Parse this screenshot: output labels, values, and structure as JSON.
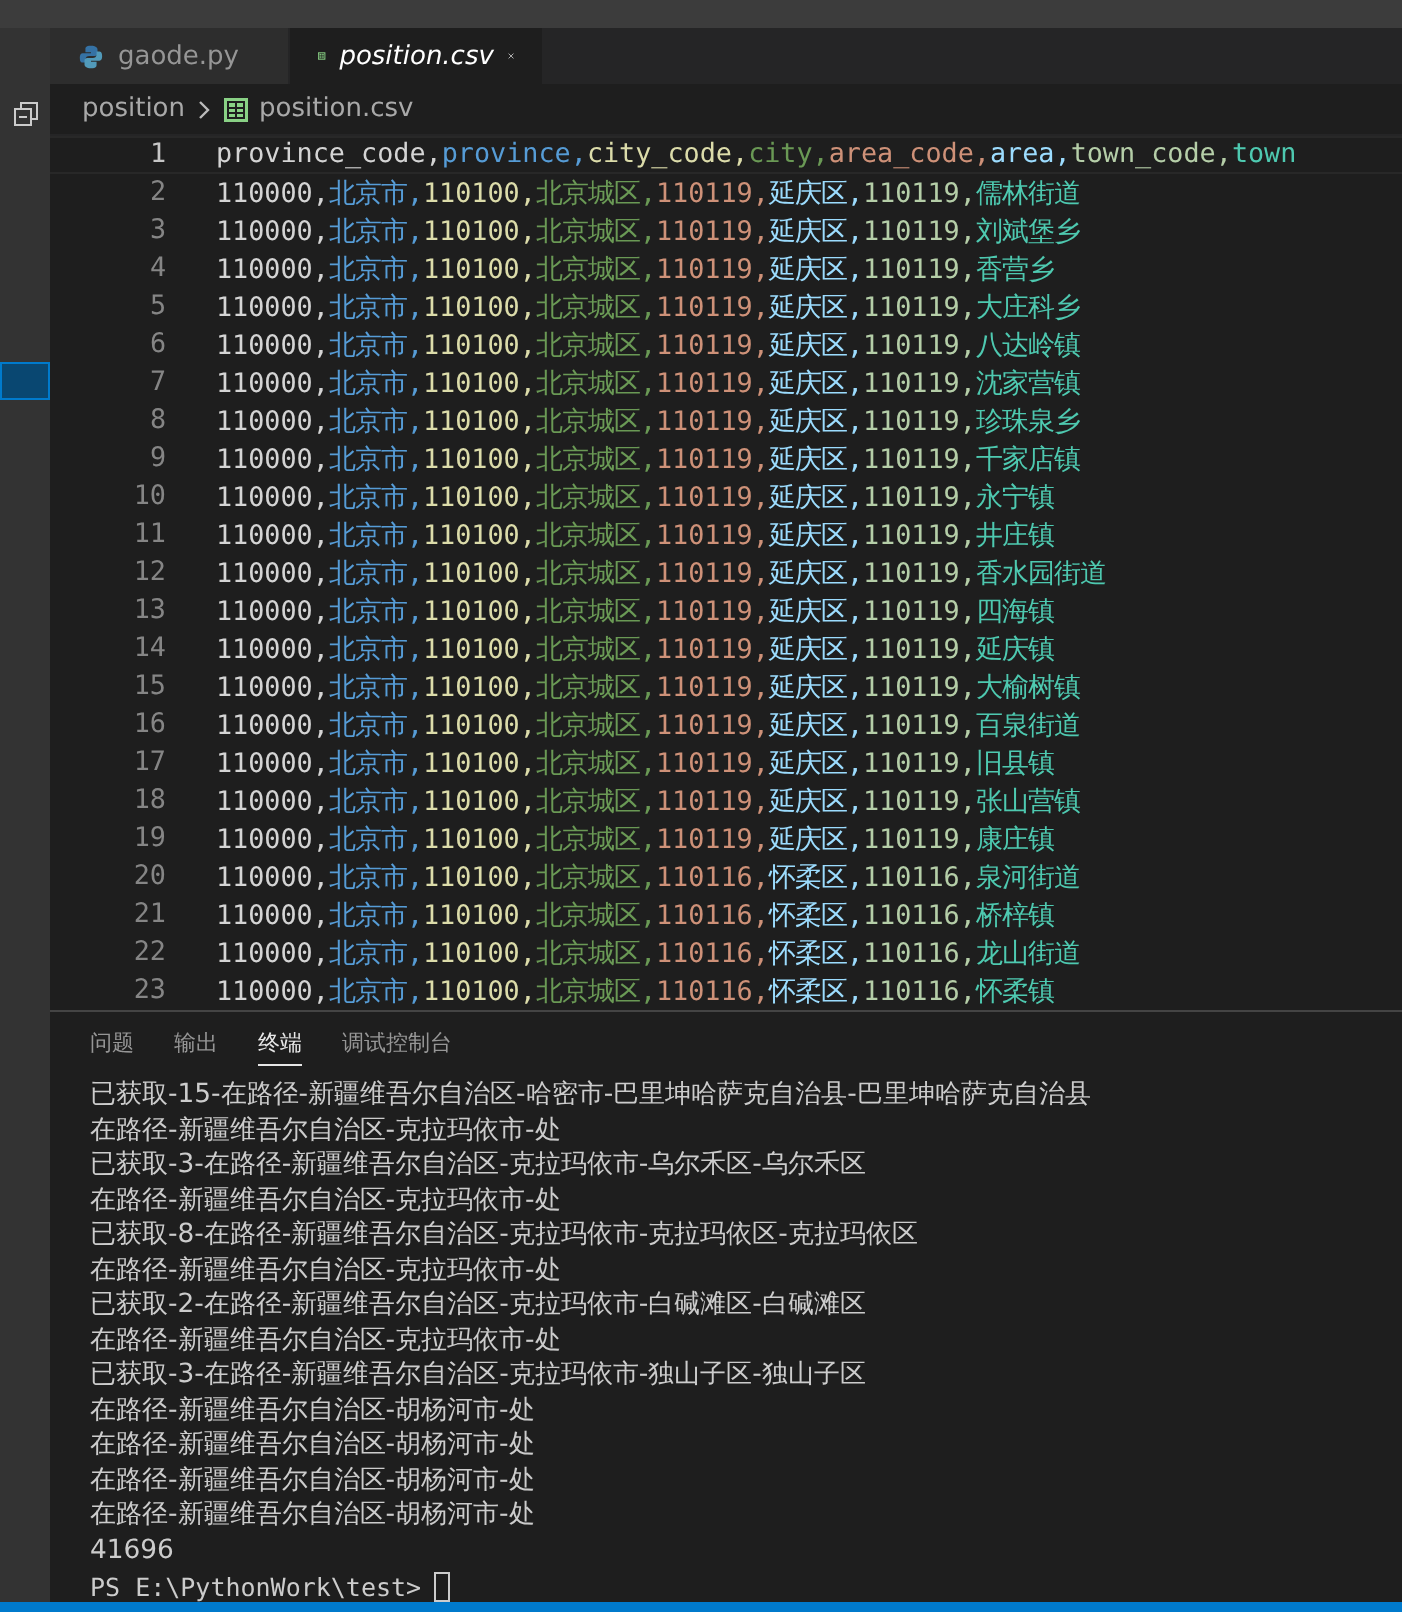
{
  "tabs": [
    {
      "label": "gaode.py",
      "kind": "python",
      "selected": false
    },
    {
      "label": "position.csv",
      "kind": "csv",
      "selected": true
    }
  ],
  "breadcrumb": {
    "folder": "position",
    "file": "position.csv"
  },
  "editor": {
    "lines": [
      {
        "number": "1",
        "fields": [
          "province_code,",
          "province,",
          "city_code,",
          "city,",
          "area_code,",
          "area,",
          "town_code,",
          "town"
        ]
      },
      {
        "number": "2",
        "fields": [
          "110000,",
          "北京市,",
          "110100,",
          "北京城区,",
          "110119,",
          "延庆区,",
          "110119,",
          "儒林街道"
        ]
      },
      {
        "number": "3",
        "fields": [
          "110000,",
          "北京市,",
          "110100,",
          "北京城区,",
          "110119,",
          "延庆区,",
          "110119,",
          "刘斌堡乡"
        ]
      },
      {
        "number": "4",
        "fields": [
          "110000,",
          "北京市,",
          "110100,",
          "北京城区,",
          "110119,",
          "延庆区,",
          "110119,",
          "香营乡"
        ]
      },
      {
        "number": "5",
        "fields": [
          "110000,",
          "北京市,",
          "110100,",
          "北京城区,",
          "110119,",
          "延庆区,",
          "110119,",
          "大庄科乡"
        ]
      },
      {
        "number": "6",
        "fields": [
          "110000,",
          "北京市,",
          "110100,",
          "北京城区,",
          "110119,",
          "延庆区,",
          "110119,",
          "八达岭镇"
        ]
      },
      {
        "number": "7",
        "fields": [
          "110000,",
          "北京市,",
          "110100,",
          "北京城区,",
          "110119,",
          "延庆区,",
          "110119,",
          "沈家营镇"
        ]
      },
      {
        "number": "8",
        "fields": [
          "110000,",
          "北京市,",
          "110100,",
          "北京城区,",
          "110119,",
          "延庆区,",
          "110119,",
          "珍珠泉乡"
        ]
      },
      {
        "number": "9",
        "fields": [
          "110000,",
          "北京市,",
          "110100,",
          "北京城区,",
          "110119,",
          "延庆区,",
          "110119,",
          "千家店镇"
        ]
      },
      {
        "number": "10",
        "fields": [
          "110000,",
          "北京市,",
          "110100,",
          "北京城区,",
          "110119,",
          "延庆区,",
          "110119,",
          "永宁镇"
        ]
      },
      {
        "number": "11",
        "fields": [
          "110000,",
          "北京市,",
          "110100,",
          "北京城区,",
          "110119,",
          "延庆区,",
          "110119,",
          "井庄镇"
        ]
      },
      {
        "number": "12",
        "fields": [
          "110000,",
          "北京市,",
          "110100,",
          "北京城区,",
          "110119,",
          "延庆区,",
          "110119,",
          "香水园街道"
        ]
      },
      {
        "number": "13",
        "fields": [
          "110000,",
          "北京市,",
          "110100,",
          "北京城区,",
          "110119,",
          "延庆区,",
          "110119,",
          "四海镇"
        ]
      },
      {
        "number": "14",
        "fields": [
          "110000,",
          "北京市,",
          "110100,",
          "北京城区,",
          "110119,",
          "延庆区,",
          "110119,",
          "延庆镇"
        ]
      },
      {
        "number": "15",
        "fields": [
          "110000,",
          "北京市,",
          "110100,",
          "北京城区,",
          "110119,",
          "延庆区,",
          "110119,",
          "大榆树镇"
        ]
      },
      {
        "number": "16",
        "fields": [
          "110000,",
          "北京市,",
          "110100,",
          "北京城区,",
          "110119,",
          "延庆区,",
          "110119,",
          "百泉街道"
        ]
      },
      {
        "number": "17",
        "fields": [
          "110000,",
          "北京市,",
          "110100,",
          "北京城区,",
          "110119,",
          "延庆区,",
          "110119,",
          "旧县镇"
        ]
      },
      {
        "number": "18",
        "fields": [
          "110000,",
          "北京市,",
          "110100,",
          "北京城区,",
          "110119,",
          "延庆区,",
          "110119,",
          "张山营镇"
        ]
      },
      {
        "number": "19",
        "fields": [
          "110000,",
          "北京市,",
          "110100,",
          "北京城区,",
          "110119,",
          "延庆区,",
          "110119,",
          "康庄镇"
        ]
      },
      {
        "number": "20",
        "fields": [
          "110000,",
          "北京市,",
          "110100,",
          "北京城区,",
          "110116,",
          "怀柔区,",
          "110116,",
          "泉河街道"
        ]
      },
      {
        "number": "21",
        "fields": [
          "110000,",
          "北京市,",
          "110100,",
          "北京城区,",
          "110116,",
          "怀柔区,",
          "110116,",
          "桥梓镇"
        ]
      },
      {
        "number": "22",
        "fields": [
          "110000,",
          "北京市,",
          "110100,",
          "北京城区,",
          "110116,",
          "怀柔区,",
          "110116,",
          "龙山街道"
        ]
      },
      {
        "number": "23",
        "fields": [
          "110000,",
          "北京市,",
          "110100,",
          "北京城区,",
          "110116,",
          "怀柔区,",
          "110116,",
          "怀柔镇"
        ]
      }
    ]
  },
  "panel": {
    "tabs": [
      {
        "label": "问题",
        "selected": false
      },
      {
        "label": "输出",
        "selected": false
      },
      {
        "label": "终端",
        "selected": true
      },
      {
        "label": "调试控制台",
        "selected": false
      }
    ],
    "terminal": {
      "lines": [
        "已获取-15-在路径-新疆维吾尔自治区-哈密市-巴里坤哈萨克自治县-巴里坤哈萨克自治县",
        "在路径-新疆维吾尔自治区-克拉玛依市-处",
        "已获取-3-在路径-新疆维吾尔自治区-克拉玛依市-乌尔禾区-乌尔禾区",
        "在路径-新疆维吾尔自治区-克拉玛依市-处",
        "已获取-8-在路径-新疆维吾尔自治区-克拉玛依市-克拉玛依区-克拉玛依区",
        "在路径-新疆维吾尔自治区-克拉玛依市-处",
        "已获取-2-在路径-新疆维吾尔自治区-克拉玛依市-白碱滩区-白碱滩区",
        "在路径-新疆维吾尔自治区-克拉玛依市-处",
        "已获取-3-在路径-新疆维吾尔自治区-克拉玛依市-独山子区-独山子区",
        "在路径-新疆维吾尔自治区-胡杨河市-处",
        "在路径-新疆维吾尔自治区-胡杨河市-处",
        "在路径-新疆维吾尔自治区-胡杨河市-处",
        "在路径-新疆维吾尔自治区-胡杨河市-处",
        "41696"
      ],
      "prompt": "PS E:\\PythonWork\\test>"
    }
  }
}
